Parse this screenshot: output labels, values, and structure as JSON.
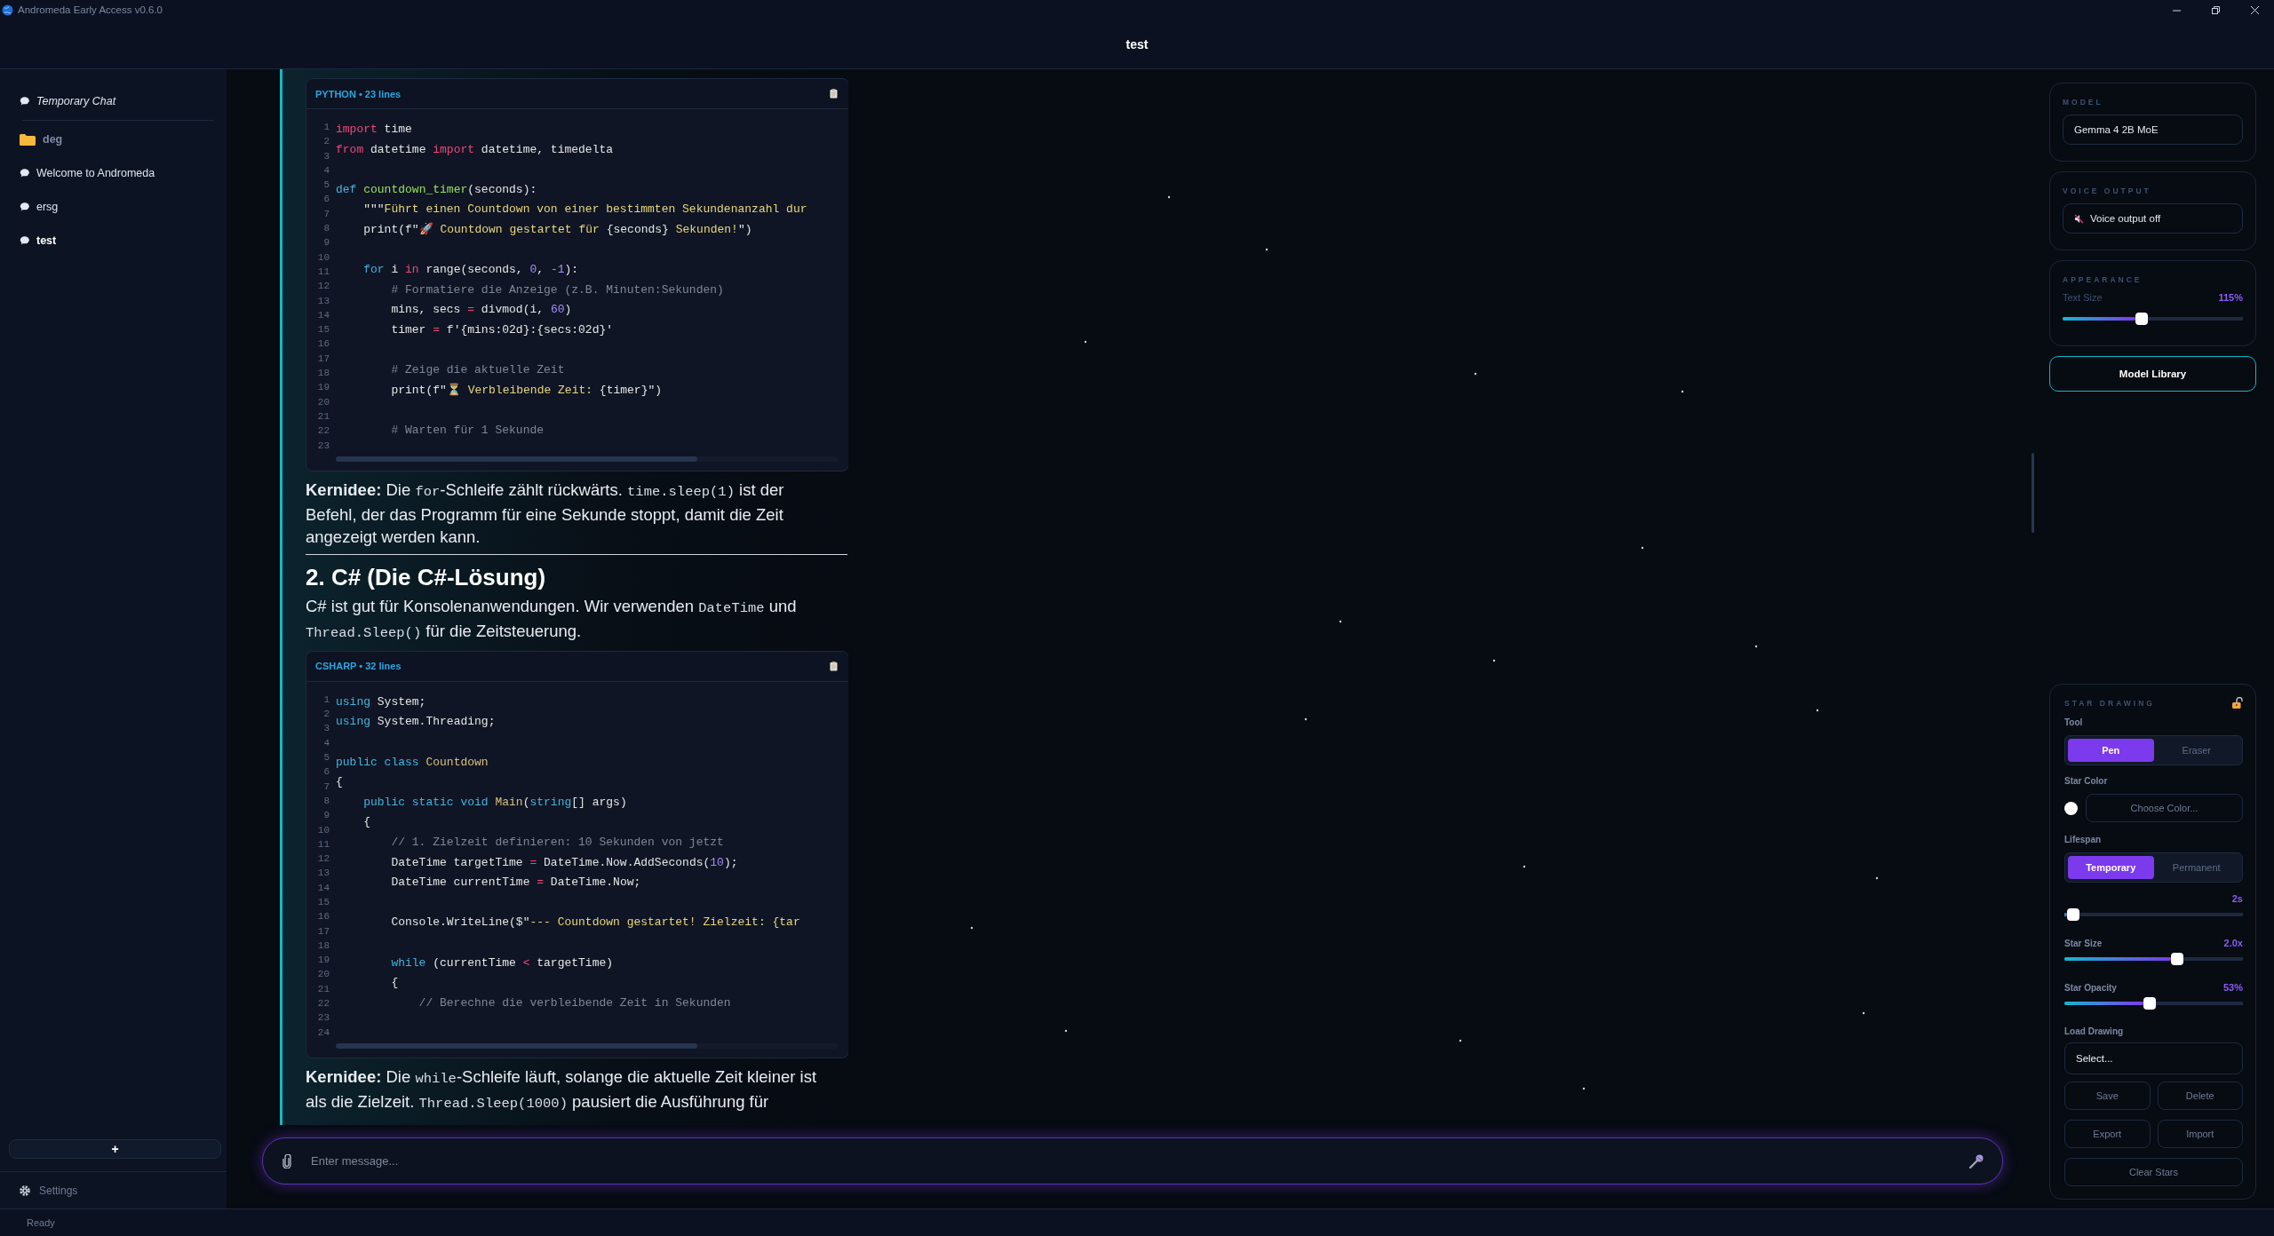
{
  "window": {
    "app_title": "Andromeda Early Access v0.6.0",
    "title": "test"
  },
  "sidebar": {
    "items": [
      {
        "kind": "temporary",
        "label": "Temporary Chat",
        "selected": false
      },
      {
        "kind": "folder",
        "label": "deg",
        "selected": false
      },
      {
        "kind": "chat",
        "label": "Welcome to Andromeda",
        "selected": false
      },
      {
        "kind": "chat",
        "label": "ersg",
        "selected": false
      },
      {
        "kind": "chat",
        "label": "test",
        "selected": true
      }
    ],
    "new_chat_button": "+",
    "settings": "Settings"
  },
  "chat": {
    "blocks": [
      {
        "kind": "code",
        "header": "PYTHON • 23 lines",
        "line_numbers": [
          "1",
          "2",
          "3",
          "4",
          "5",
          "6",
          "7",
          "8",
          "9",
          "10",
          "11",
          "12",
          "13",
          "14",
          "15",
          "16",
          "17",
          "18",
          "19",
          "20",
          "21",
          "22",
          "23"
        ],
        "lines": [
          {
            "kind": "code",
            "tokens": [
              {
                "kind": "kw",
                "text": "import"
              },
              {
                "kind": "p",
                "text": " time"
              }
            ]
          },
          {
            "kind": "code",
            "tokens": [
              {
                "kind": "kw",
                "text": "from"
              },
              {
                "kind": "p",
                "text": " datetime "
              },
              {
                "kind": "kw",
                "text": "import"
              },
              {
                "kind": "p",
                "text": " datetime, timedelta"
              }
            ]
          },
          {
            "kind": "blank"
          },
          {
            "kind": "code",
            "tokens": [
              {
                "kind": "kw2",
                "text": "def "
              },
              {
                "kind": "fn",
                "text": "countdown_timer"
              },
              {
                "kind": "p",
                "text": "(seconds):"
              }
            ]
          },
          {
            "kind": "code",
            "tokens": [
              {
                "kind": "p",
                "text": "    \"\"\""
              },
              {
                "kind": "str",
                "text": "Führt einen Countdown von einer bestimmten Sekundenanzahl dur"
              }
            ]
          },
          {
            "kind": "code",
            "tokens": [
              {
                "kind": "p",
                "text": "    print(f\"🚀"
              },
              {
                "kind": "str",
                "text": " Countdown gestartet für "
              },
              {
                "kind": "p",
                "text": "{seconds}"
              },
              {
                "kind": "str",
                "text": " Sekunden!"
              },
              {
                "kind": "p",
                "text": "\")"
              }
            ]
          },
          {
            "kind": "blank"
          },
          {
            "kind": "code",
            "tokens": [
              {
                "kind": "kw2",
                "text": "    for"
              },
              {
                "kind": "p",
                "text": " i "
              },
              {
                "kind": "kw",
                "text": "in"
              },
              {
                "kind": "p",
                "text": " range(seconds, "
              },
              {
                "kind": "num",
                "text": "0"
              },
              {
                "kind": "p",
                "text": ", "
              },
              {
                "kind": "num",
                "text": "-1"
              },
              {
                "kind": "p",
                "text": "):"
              }
            ]
          },
          {
            "kind": "code",
            "tokens": [
              {
                "kind": "com",
                "text": "        # Formatiere die Anzeige (z.B. Minuten:Sekunden)"
              }
            ]
          },
          {
            "kind": "code",
            "tokens": [
              {
                "kind": "p",
                "text": "        mins, secs "
              },
              {
                "kind": "kw",
                "text": "="
              },
              {
                "kind": "p",
                "text": " divmod(i, "
              },
              {
                "kind": "num",
                "text": "60"
              },
              {
                "kind": "p",
                "text": ")"
              }
            ]
          },
          {
            "kind": "code",
            "tokens": [
              {
                "kind": "p",
                "text": "        timer "
              },
              {
                "kind": "kw",
                "text": "="
              },
              {
                "kind": "p",
                "text": " f'{mins:02d}:{secs:02d}'"
              }
            ]
          },
          {
            "kind": "blank"
          },
          {
            "kind": "code",
            "tokens": [
              {
                "kind": "com",
                "text": "        # Zeige die aktuelle Zeit"
              }
            ]
          },
          {
            "kind": "code",
            "tokens": [
              {
                "kind": "p",
                "text": "        print(f\"⏳"
              },
              {
                "kind": "str",
                "text": " Verbleibende Zeit: "
              },
              {
                "kind": "p",
                "text": "{timer}\")"
              }
            ]
          },
          {
            "kind": "blank"
          },
          {
            "kind": "code",
            "tokens": [
              {
                "kind": "com",
                "text": "        # Warten für 1 Sekunde"
              }
            ]
          }
        ]
      },
      {
        "kind": "paragraph",
        "parts": [
          {
            "kind": "bold",
            "text": "Kernidee:"
          },
          {
            "kind": "text",
            "text": " Die "
          },
          {
            "kind": "code",
            "text": "for"
          },
          {
            "kind": "text",
            "text": "-Schleife zählt rückwärts. "
          },
          {
            "kind": "code",
            "text": "time.sleep(1)"
          },
          {
            "kind": "text",
            "text": " ist der Befehl, der das Programm für eine Sekunde stoppt, damit die Zeit angezeigt werden kann."
          }
        ]
      },
      {
        "kind": "rule"
      },
      {
        "kind": "heading",
        "text": "2. C# (Die C#-Lösung)"
      },
      {
        "kind": "paragraph",
        "parts": [
          {
            "kind": "text",
            "text": "C# ist gut für Konsolenanwendungen. Wir verwenden "
          },
          {
            "kind": "code",
            "text": "DateTime"
          },
          {
            "kind": "text",
            "text": " und "
          },
          {
            "kind": "code",
            "text": "Thread.Sleep()"
          },
          {
            "kind": "text",
            "text": " für die Zeitsteuerung."
          }
        ]
      },
      {
        "kind": "code",
        "header": "CSHARP • 32 lines",
        "line_numbers": [
          "1",
          "2",
          "3",
          "4",
          "5",
          "6",
          "7",
          "8",
          "9",
          "10",
          "11",
          "12",
          "13",
          "14",
          "15",
          "16",
          "17",
          "18",
          "19",
          "20",
          "21",
          "22",
          "23",
          "24"
        ],
        "lines": [
          {
            "kind": "code",
            "tokens": [
              {
                "kind": "kw2",
                "text": "using"
              },
              {
                "kind": "p",
                "text": " System;"
              }
            ]
          },
          {
            "kind": "code",
            "tokens": [
              {
                "kind": "kw2",
                "text": "using"
              },
              {
                "kind": "p",
                "text": " System.Threading;"
              }
            ]
          },
          {
            "kind": "blank"
          },
          {
            "kind": "code",
            "tokens": [
              {
                "kind": "kw2",
                "text": "public class "
              },
              {
                "kind": "cls",
                "text": "Countdown"
              }
            ]
          },
          {
            "kind": "code",
            "tokens": [
              {
                "kind": "p",
                "text": "{"
              }
            ]
          },
          {
            "kind": "code",
            "tokens": [
              {
                "kind": "kw2",
                "text": "    public static void "
              },
              {
                "kind": "cls",
                "text": "Main"
              },
              {
                "kind": "p",
                "text": "("
              },
              {
                "kind": "kw2",
                "text": "string"
              },
              {
                "kind": "p",
                "text": "[] args)"
              }
            ]
          },
          {
            "kind": "code",
            "tokens": [
              {
                "kind": "p",
                "text": "    {"
              }
            ]
          },
          {
            "kind": "code",
            "tokens": [
              {
                "kind": "com",
                "text": "        // 1. Zielzeit definieren: 10 Sekunden von jetzt"
              }
            ]
          },
          {
            "kind": "code",
            "tokens": [
              {
                "kind": "p",
                "text": "        DateTime targetTime "
              },
              {
                "kind": "kw",
                "text": "="
              },
              {
                "kind": "p",
                "text": " DateTime.Now.AddSeconds("
              },
              {
                "kind": "num",
                "text": "10"
              },
              {
                "kind": "p",
                "text": ");"
              }
            ]
          },
          {
            "kind": "code",
            "tokens": [
              {
                "kind": "p",
                "text": "        DateTime currentTime "
              },
              {
                "kind": "kw",
                "text": "="
              },
              {
                "kind": "p",
                "text": " DateTime.Now;"
              }
            ]
          },
          {
            "kind": "blank"
          },
          {
            "kind": "code",
            "tokens": [
              {
                "kind": "p",
                "text": "        Console.WriteLine($\""
              },
              {
                "kind": "str",
                "text": "--- Countdown gestartet! Zielzeit: {tar"
              }
            ]
          },
          {
            "kind": "blank"
          },
          {
            "kind": "code",
            "tokens": [
              {
                "kind": "kw2",
                "text": "        while"
              },
              {
                "kind": "p",
                "text": " (currentTime "
              },
              {
                "kind": "kw",
                "text": "<"
              },
              {
                "kind": "p",
                "text": " targetTime)"
              }
            ]
          },
          {
            "kind": "code",
            "tokens": [
              {
                "kind": "p",
                "text": "        {"
              }
            ]
          },
          {
            "kind": "code",
            "tokens": [
              {
                "kind": "com",
                "text": "            // Berechne die verbleibende Zeit in Sekunden"
              }
            ]
          }
        ]
      },
      {
        "kind": "paragraph",
        "parts": [
          {
            "kind": "bold",
            "text": "Kernidee:"
          },
          {
            "kind": "text",
            "text": " Die "
          },
          {
            "kind": "code",
            "text": "while"
          },
          {
            "kind": "text",
            "text": "-Schleife läuft, solange die aktuelle Zeit kleiner ist als die Zielzeit. "
          },
          {
            "kind": "code",
            "text": "Thread.Sleep(1000)"
          },
          {
            "kind": "text",
            "text": " pausiert die Ausführung für"
          }
        ]
      }
    ]
  },
  "composer": {
    "placeholder": "Enter message..."
  },
  "right_panel": {
    "model": {
      "label": "MODEL",
      "value": "Gemma 4 2B MoE"
    },
    "voice_output": {
      "label": "VOICE OUTPUT",
      "button": "Voice output off",
      "on": false
    },
    "appearance": {
      "label": "APPEARANCE",
      "text_size": {
        "label": "Text Size",
        "reading": "115%",
        "level": 0.44
      }
    },
    "model_library_button": "Model Library",
    "star_drawing": {
      "label": "STAR DRAWING",
      "locked": false,
      "tool": {
        "label": "Tool",
        "options": [
          {
            "label": "Pen",
            "selected": true
          },
          {
            "label": "Eraser",
            "selected": false
          }
        ]
      },
      "star_color": {
        "label": "Star Color",
        "color": "#ffffff",
        "button": "Choose Color..."
      },
      "lifespan": {
        "label": "Lifespan",
        "options": [
          {
            "label": "Temporary",
            "selected": true
          },
          {
            "label": "Permanent",
            "selected": false
          }
        ],
        "reading": "2s",
        "level": 0.05
      },
      "star_size": {
        "label": "Star Size",
        "reading": "2.0x",
        "level": 0.63
      },
      "star_opacity": {
        "label": "Star Opacity",
        "reading": "53%",
        "level": 0.48
      },
      "load_drawing": {
        "label": "Load Drawing",
        "value": "Select..."
      },
      "buttons": [
        "Save",
        "Delete",
        "Export",
        "Import"
      ],
      "clear_button": "Clear Stars"
    }
  },
  "status_bar": {
    "text": "Ready"
  }
}
